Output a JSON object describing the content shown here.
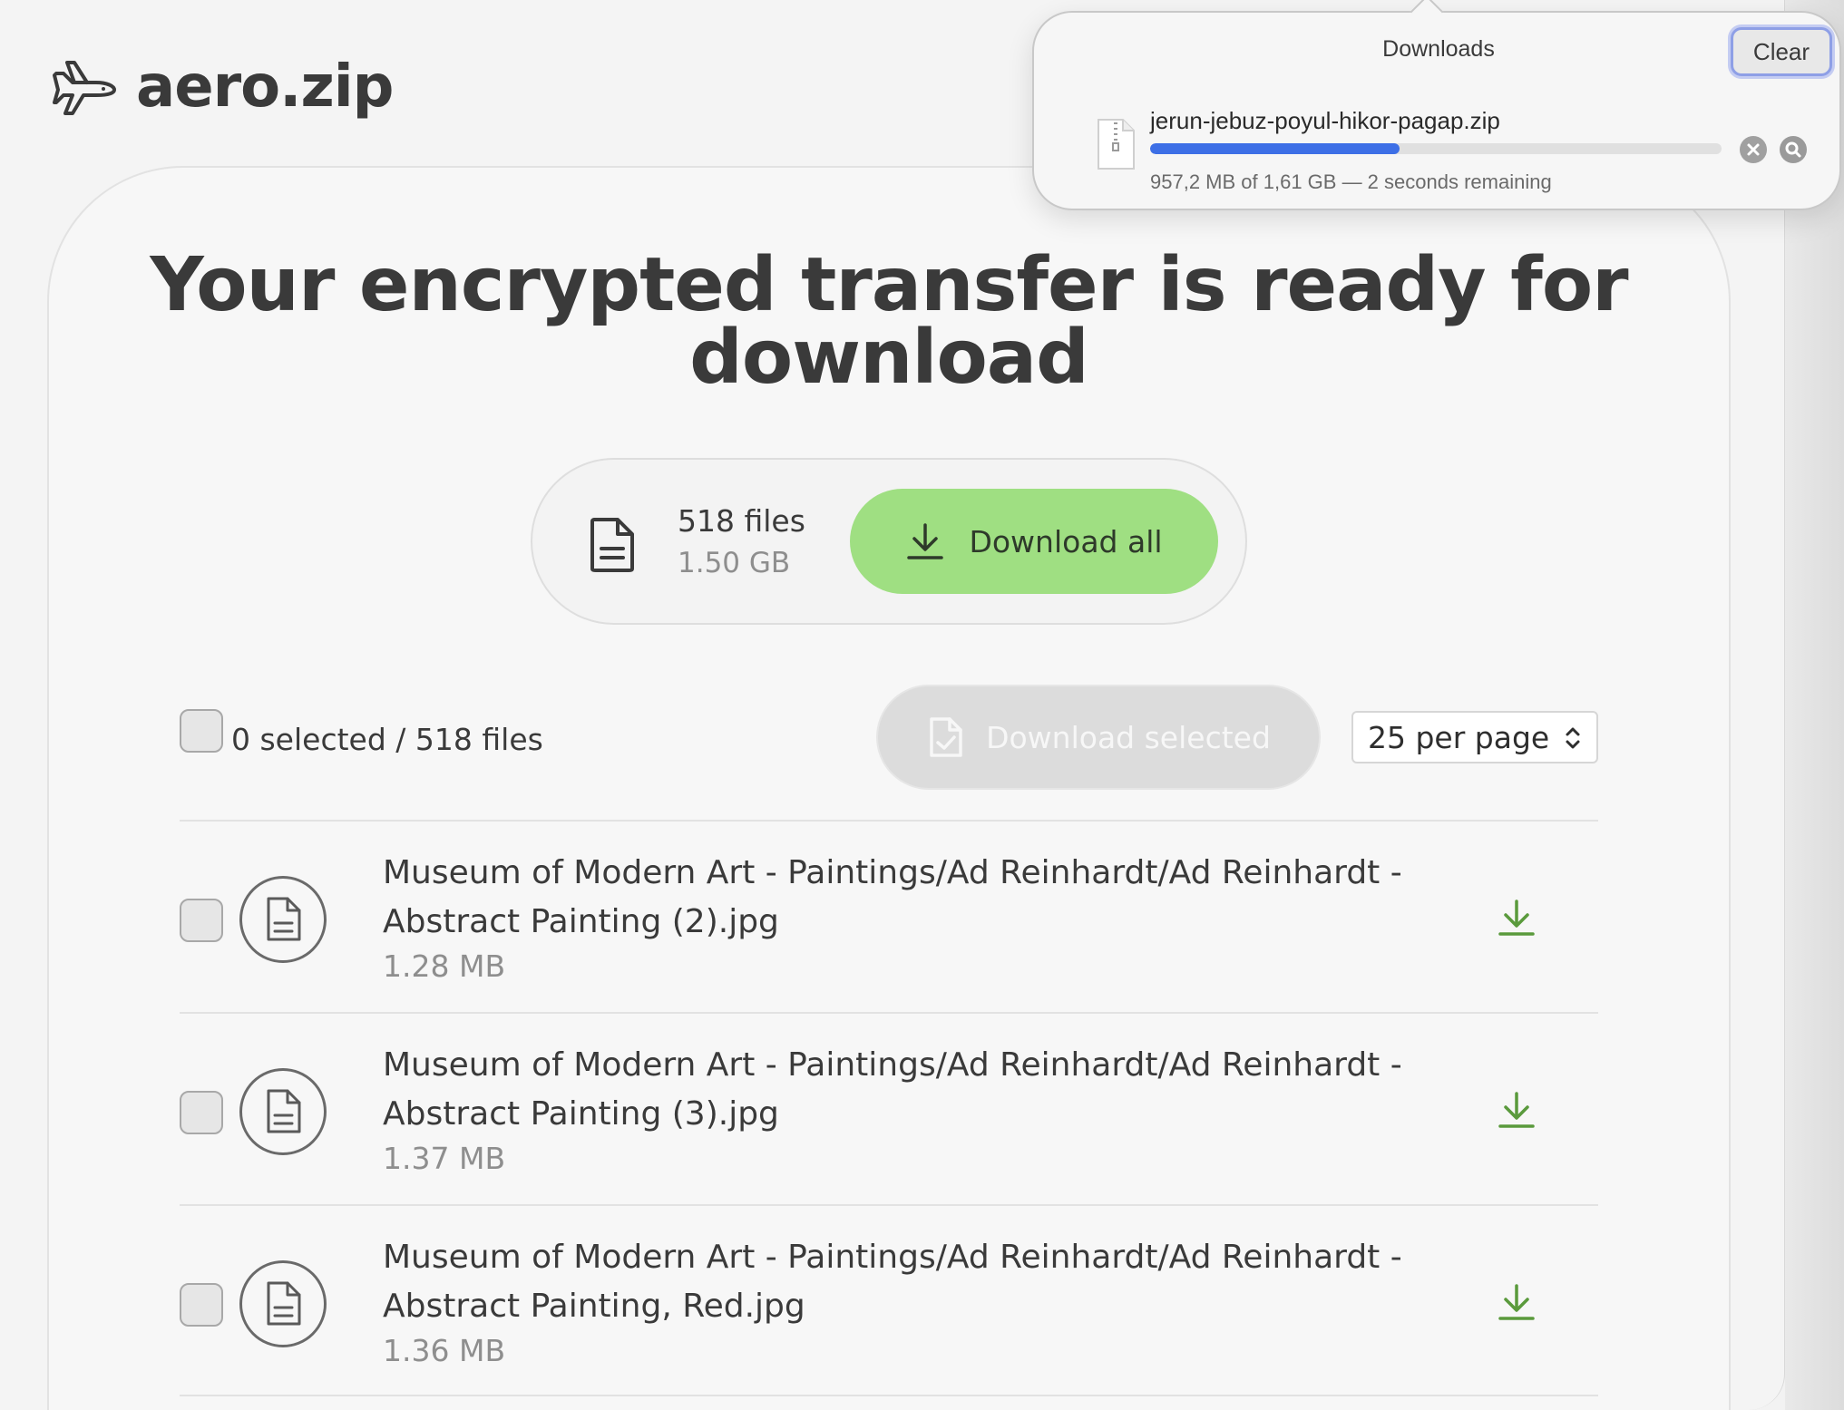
{
  "header": {
    "logo_text": "aero.zip",
    "logo_icon": "airplane-icon"
  },
  "main": {
    "headline": "Your encrypted transfer is ready for download",
    "summary": {
      "file_count": "518 files",
      "total_size": "1.50 GB",
      "download_all_label": "Download all"
    },
    "toolbar": {
      "selection_text": "0 selected / 518 files",
      "download_selected_label": "Download selected",
      "per_page_value": "25 per page"
    },
    "files": [
      {
        "name": "Museum of Modern Art - Paintings/Ad Reinhardt/Ad Reinhardt - Abstract Painting (2).jpg",
        "size": "1.28 MB"
      },
      {
        "name": "Museum of Modern Art - Paintings/Ad Reinhardt/Ad Reinhardt - Abstract Painting (3).jpg",
        "size": "1.37 MB"
      },
      {
        "name": "Museum of Modern Art - Paintings/Ad Reinhardt/Ad Reinhardt - Abstract Painting, Red.jpg",
        "size": "1.36 MB"
      }
    ]
  },
  "downloads_popup": {
    "title": "Downloads",
    "clear_label": "Clear",
    "filename": "jerun-jebuz-poyul-hikor-pagap.zip",
    "status": "957,2 MB of 1,61 GB — 2 seconds remaining",
    "progress_fraction": 0.436
  },
  "colors": {
    "accent_green": "#9fdf82",
    "download_icon_green": "#5a9a3c",
    "progress_blue": "#3d6fe6"
  }
}
